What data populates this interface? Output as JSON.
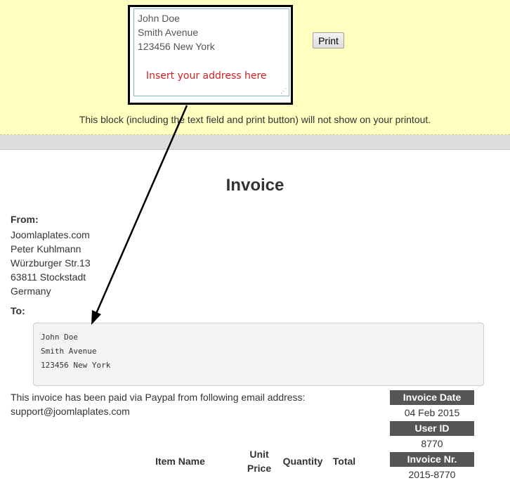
{
  "printbar": {
    "textarea_lines": [
      "John Doe",
      "Smith Avenue",
      "123456 New York"
    ],
    "hint": "Insert your address here",
    "print_label": "Print",
    "note": "This block (including the text field and print button) will not show on your printout."
  },
  "invoice": {
    "title": "Invoice",
    "from_label": "From:",
    "from_lines": [
      "Joomlaplates.com",
      "Peter Kuhlmann",
      "Würzburger Str.13",
      "63811 Stockstadt",
      "Germany"
    ],
    "to_label": "To:",
    "to_lines": [
      "John Doe",
      "Smith Avenue",
      "123456 New York"
    ],
    "paid_lines": [
      "This invoice has been paid via Paypal from following email address:",
      "support@joomlaplates.com"
    ],
    "meta": {
      "invoice_date_label": "Invoice Date",
      "invoice_date": "04 Feb 2015",
      "user_id_label": "User ID",
      "user_id": "8770",
      "invoice_nr_label": "Invoice Nr.",
      "invoice_nr": "2015-8770"
    },
    "table_headers": {
      "item_name": "Item Name",
      "unit_price_1": "Unit",
      "unit_price_2": "Price",
      "quantity": "Quantity",
      "total": "Total"
    }
  },
  "colors": {
    "printbar_bg": "#ffffc0",
    "hint": "#d02020",
    "meta_header_bg": "#555555"
  }
}
